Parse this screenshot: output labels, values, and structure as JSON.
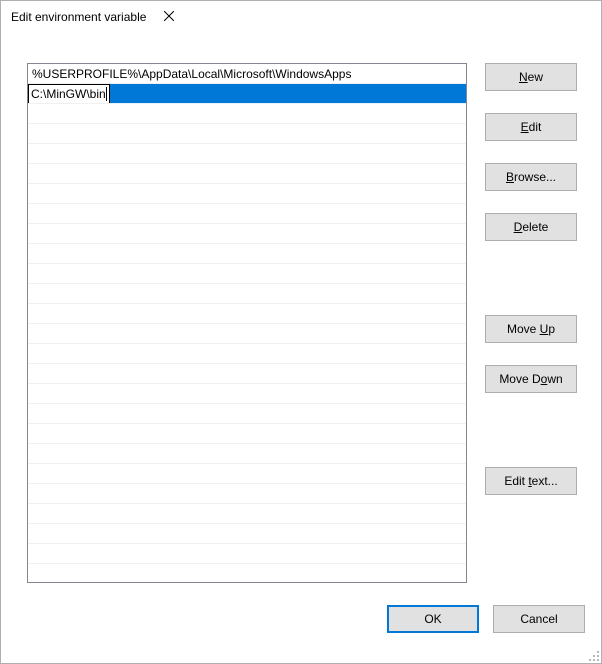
{
  "titlebar": {
    "title": "Edit environment variable"
  },
  "list": {
    "row0": "%USERPROFILE%\\AppData\\Local\\Microsoft\\WindowsApps",
    "editing": "C:\\MinGW\\bin"
  },
  "buttons": {
    "new_before": "",
    "new_accel": "N",
    "new_after": "ew",
    "edit_before": "",
    "edit_accel": "E",
    "edit_after": "dit",
    "browse_before": "",
    "browse_accel": "B",
    "browse_after": "rowse...",
    "delete_before": "",
    "delete_accel": "D",
    "delete_after": "elete",
    "moveup_before": "Move ",
    "moveup_accel": "U",
    "moveup_after": "p",
    "movedown_before": "Move D",
    "movedown_accel": "o",
    "movedown_after": "wn",
    "edittext_before": "Edit ",
    "edittext_accel": "t",
    "edittext_after": "ext..."
  },
  "footer": {
    "ok": "OK",
    "cancel": "Cancel"
  }
}
